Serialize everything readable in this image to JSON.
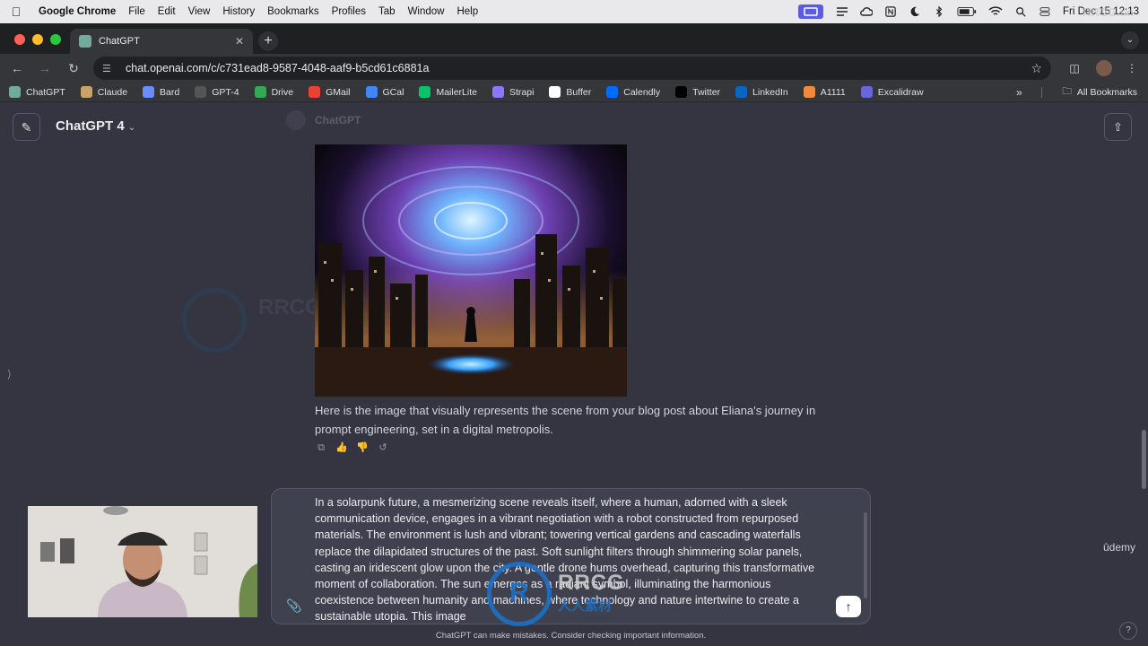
{
  "menubar": {
    "app_name": "Google Chrome",
    "items": [
      "File",
      "Edit",
      "View",
      "History",
      "Bookmarks",
      "Profiles",
      "Tab",
      "Window",
      "Help"
    ],
    "clock": "Fri Dec 15  12:13"
  },
  "browser": {
    "tab_title": "ChatGPT",
    "url": "chat.openai.com/c/c731ead8-9587-4048-aaf9-b5cd61c6881a",
    "bookmarks": [
      {
        "label": "ChatGPT",
        "icon": "chatgpt-icon",
        "color": "#74aa9c"
      },
      {
        "label": "Claude",
        "icon": "claude-icon",
        "color": "#c8a36a"
      },
      {
        "label": "Bard",
        "icon": "bard-icon",
        "color": "#6b8cff"
      },
      {
        "label": "GPT-4",
        "icon": "openai-icon",
        "color": "#555"
      },
      {
        "label": "Drive",
        "icon": "drive-icon",
        "color": "#34a853"
      },
      {
        "label": "GMail",
        "icon": "gmail-icon",
        "color": "#ea4335"
      },
      {
        "label": "GCal",
        "icon": "calendar-icon",
        "color": "#4285f4"
      },
      {
        "label": "MailerLite",
        "icon": "mailerlite-icon",
        "color": "#09c269"
      },
      {
        "label": "Strapi",
        "icon": "strapi-icon",
        "color": "#8e75ff"
      },
      {
        "label": "Buffer",
        "icon": "buffer-icon",
        "color": "#ffffff"
      },
      {
        "label": "Calendly",
        "icon": "calendly-icon",
        "color": "#006bff"
      },
      {
        "label": "Twitter",
        "icon": "x-icon",
        "color": "#000000"
      },
      {
        "label": "LinkedIn",
        "icon": "linkedin-icon",
        "color": "#0a66c2"
      },
      {
        "label": "A1111",
        "icon": "a1111-icon",
        "color": "#f08a3c"
      },
      {
        "label": "Excalidraw",
        "icon": "excalidraw-icon",
        "color": "#6965db"
      }
    ],
    "all_bookmarks": "All Bookmarks"
  },
  "chat": {
    "model_label": "ChatGPT 4",
    "sender_name": "ChatGPT",
    "reply_text": "Here is the image that visually represents the scene from your blog post about Eliana's journey in prompt engineering, set in a digital metropolis.",
    "composer_text": "In a solarpunk future, a mesmerizing scene reveals itself, where a human, adorned with a sleek communication device, engages in a vibrant negotiation with a robot constructed from repurposed materials. The environment is lush and vibrant; towering vertical gardens and cascading waterfalls replace the dilapidated structures of the past. Soft sunlight filters through shimmering solar panels, casting an iridescent glow upon the city. A gentle drone hums overhead, capturing this transformative moment of collaboration. The sun emerges as a radiant symbol, illuminating the harmonious coexistence between humanity and machines, where technology and nature intertwine to create a sustainable utopia. This image",
    "disclaimer": "ChatGPT can make mistakes. Consider checking important information.",
    "help_label": "?"
  },
  "overlay": {
    "udemy": "ûdemy",
    "watermark_big": "RRCG",
    "watermark_small": "人人素材",
    "corner_watermark": "RRCG.cn"
  },
  "colors": {
    "page_bg": "#343541",
    "composer_bg": "#40414f",
    "accent": "#1c6fc5"
  }
}
